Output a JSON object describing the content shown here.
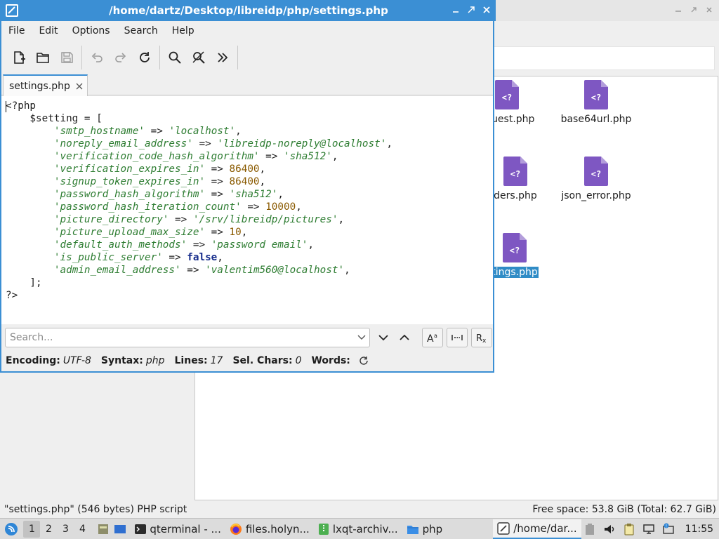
{
  "file_manager": {
    "files": [
      {
        "name": "equest.php",
        "selected": false
      },
      {
        "name": "base64url.php",
        "selected": false
      },
      {
        "name": "ders.php",
        "selected": false
      },
      {
        "name": "json_error.php",
        "selected": false
      },
      {
        "name": "tings.php",
        "selected": true
      }
    ],
    "status_left": "\"settings.php\" (546 bytes) PHP script",
    "status_right": "Free space: 53.8 GiB (Total: 62.7 GiB)"
  },
  "editor_window": {
    "title": "/home/dartz/Desktop/libreidp/php/settings.php",
    "menu": [
      "File",
      "Edit",
      "Options",
      "Search",
      "Help"
    ],
    "toolbar_icons": [
      "new-file-icon",
      "open-folder-icon",
      "save-icon",
      "undo-icon",
      "redo-icon",
      "reload-icon",
      "find-icon",
      "replace-icon",
      "more-icon"
    ],
    "tab_label": "settings.php",
    "code": {
      "line1": "<?php",
      "line2": "    $setting = [",
      "entries": [
        {
          "key": "'smtp_hostname'",
          "value": "'localhost'",
          "type": "string"
        },
        {
          "key": "'noreply_email_address'",
          "value": "'libreidp-noreply@localhost'",
          "type": "string"
        },
        {
          "key": "'verification_code_hash_algorithm'",
          "value": "'sha512'",
          "type": "string"
        },
        {
          "key": "'verification_expires_in'",
          "value": "86400",
          "type": "number"
        },
        {
          "key": "'signup_token_expires_in'",
          "value": "86400",
          "type": "number"
        },
        {
          "key": "'password_hash_algorithm'",
          "value": "'sha512'",
          "type": "string"
        },
        {
          "key": "'password_hash_iteration_count'",
          "value": "10000",
          "type": "number"
        },
        {
          "key": "'picture_directory'",
          "value": "'/srv/libreidp/pictures'",
          "type": "string"
        },
        {
          "key": "'picture_upload_max_size'",
          "value": "10",
          "type": "number"
        },
        {
          "key": "'default_auth_methods'",
          "value": "'password email'",
          "type": "string"
        },
        {
          "key": "'is_public_server'",
          "value": "false",
          "type": "keyword"
        },
        {
          "key": "'admin_email_address'",
          "value": "'valentim560@localhost'",
          "type": "string"
        }
      ],
      "close_line": "    ];",
      "end_line": "?>"
    },
    "search_placeholder": "Search...",
    "status": {
      "encoding_label": "Encoding:",
      "encoding_value": "UTF-8",
      "syntax_label": "Syntax:",
      "syntax_value": "php",
      "lines_label": "Lines:",
      "lines_value": "17",
      "sel_label": "Sel. Chars:",
      "sel_value": "0",
      "words_label": "Words:"
    }
  },
  "taskbar": {
    "desktops": [
      "1",
      "2",
      "3",
      "4"
    ],
    "active_desktop": "1",
    "tasks": [
      {
        "label": "qterminal - ...",
        "icon": "terminal-icon"
      },
      {
        "label": "files.holyn...",
        "icon": "firefox-icon"
      },
      {
        "label": "lxqt-archiv...",
        "icon": "archive-icon"
      },
      {
        "label": "php",
        "icon": "folder-icon"
      },
      {
        "label": "/home/dar...",
        "icon": "editor-icon",
        "active": true
      }
    ],
    "clock": "11:55"
  },
  "colors": {
    "accent": "#3b8fd4",
    "selection": "#308cc6",
    "php_icon": "#7e57c2",
    "string": "#2e7d32",
    "number": "#8a5a00",
    "keyword": "#152b8b"
  }
}
